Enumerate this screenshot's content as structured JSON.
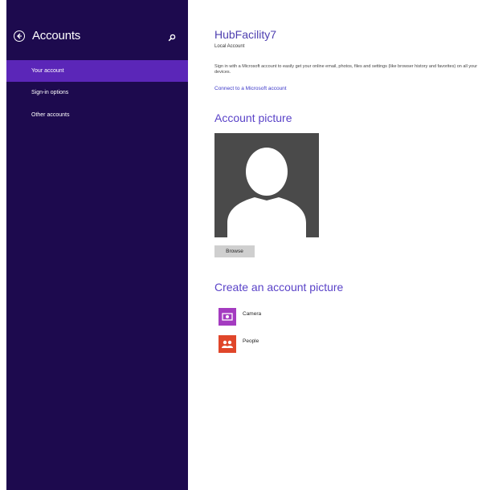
{
  "sidebar": {
    "title": "Accounts",
    "back_icon": "back-arrow-icon",
    "search_icon": "search-icon",
    "items": [
      {
        "label": "Your account",
        "active": true
      },
      {
        "label": "Sign-in options",
        "active": false
      },
      {
        "label": "Other accounts",
        "active": false
      }
    ]
  },
  "account": {
    "user_name": "HubFacility7",
    "account_type": "Local Account",
    "description": "Sign in with a Microsoft account to easily get your online email, photos, files and settings (like browser history and favorites) on all your devices.",
    "connect_link": "Connect to a Microsoft account"
  },
  "picture": {
    "title": "Account picture",
    "browse_label": "Browse"
  },
  "create": {
    "title": "Create an account picture",
    "apps": [
      {
        "label": "Camera",
        "icon": "camera-icon",
        "color": "#a43bc0"
      },
      {
        "label": "People",
        "icon": "people-icon",
        "color": "#e0462a"
      }
    ]
  },
  "colors": {
    "sidebar_bg": "#1d0a4e",
    "sidebar_active": "#5b26b8",
    "accent_text": "#5a43c8"
  }
}
